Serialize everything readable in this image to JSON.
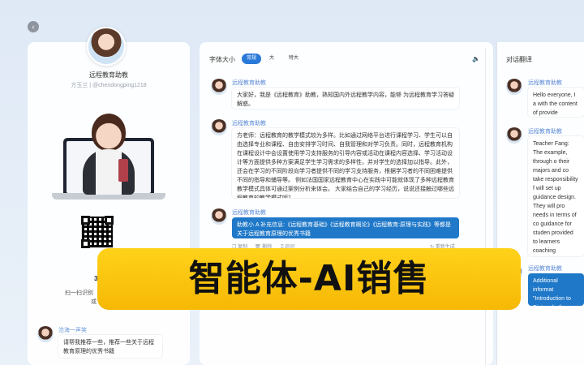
{
  "assistant": {
    "name": "远程教育助教",
    "subtitle": "方玉兰 | @chendongping1218"
  },
  "left_panel": {
    "qr_caption_num": "3",
    "qr_caption_1": "扫一扫识别",
    "qr_caption_2": "或",
    "user_message": {
      "label": "沧海一声笑",
      "text": "请帮我推荐一些，推荐一些关于远程教育原理的优秀书籍"
    }
  },
  "toolbar": {
    "font_size_label": "字体大小",
    "options": [
      "常规",
      "大",
      "特大"
    ],
    "selected": "常规",
    "speaker_icon": "speaker-icon"
  },
  "chat": {
    "messages": [
      {
        "label": "远程教育助教",
        "text": "大家好，我是《远程教育》助教，熟知国内外远程教学内容，能够 为远程教育学习答疑解惑。"
      },
      {
        "label": "远程教育助教",
        "text": "方老师：远程教育的教学模式较为多样。比如通过网络平台进行课程学习、学生可以自由选择专业和课程、自由安排学习时间、自我管理和对学习负责。同时，远程教育机构在课程设计中会设置使用学习支持服务的引导内容或活动在课程内容选择、学习活动设计等方面提供多种方案满足学生学习需求的多样性，并对学生的选择加以指导。此外，还会在学习的不同阶段向学习者提供不同的学习支持服务，根据学习者的不同困难提供不同的指导和辅导等。  例如法国国家远程教育中心在实践中可能就体现了多种远程教育教学模式具体可通过案例分析来体会。  大家结合自己的学习经历，说说还接触过哪些远程教育的教学模式呢？"
      },
      {
        "label": "远程教育助教",
        "text": "助教小 A 补充信息:《远程教育基础》《远程教育概论》《远程教育:原理与实践》等都是关于远程教育原理的优秀书籍"
      }
    ],
    "actions": {
      "copy": "复制",
      "delete": "删除",
      "quote": "追问",
      "regenerate": "重新生成"
    }
  },
  "translation": {
    "title": "对话翻译",
    "messages": [
      {
        "label": "远程教育助教",
        "text": "Hello everyone, I a with the content of provide answers an"
      },
      {
        "label": "远程教育助教",
        "text": "Teacher Fang: The example, through o their majors and co take responsibility f will set up guidance design. They will pro needs in terms of co guidance for studen provided to learners coaching according Distance Educatio teaching models in other remote educa own learning experi"
      },
      {
        "label": "远程教育助教",
        "text": "Additional informat \"Introduction to Dist and other excellent"
      }
    ]
  },
  "banner": {
    "text": "智能体-AI销售"
  },
  "colors": {
    "accent": "#2879d8",
    "bubble_blue": "#1f78c8",
    "banner_yellow": "#ffd21a",
    "label_blue": "#5b8bd6"
  }
}
